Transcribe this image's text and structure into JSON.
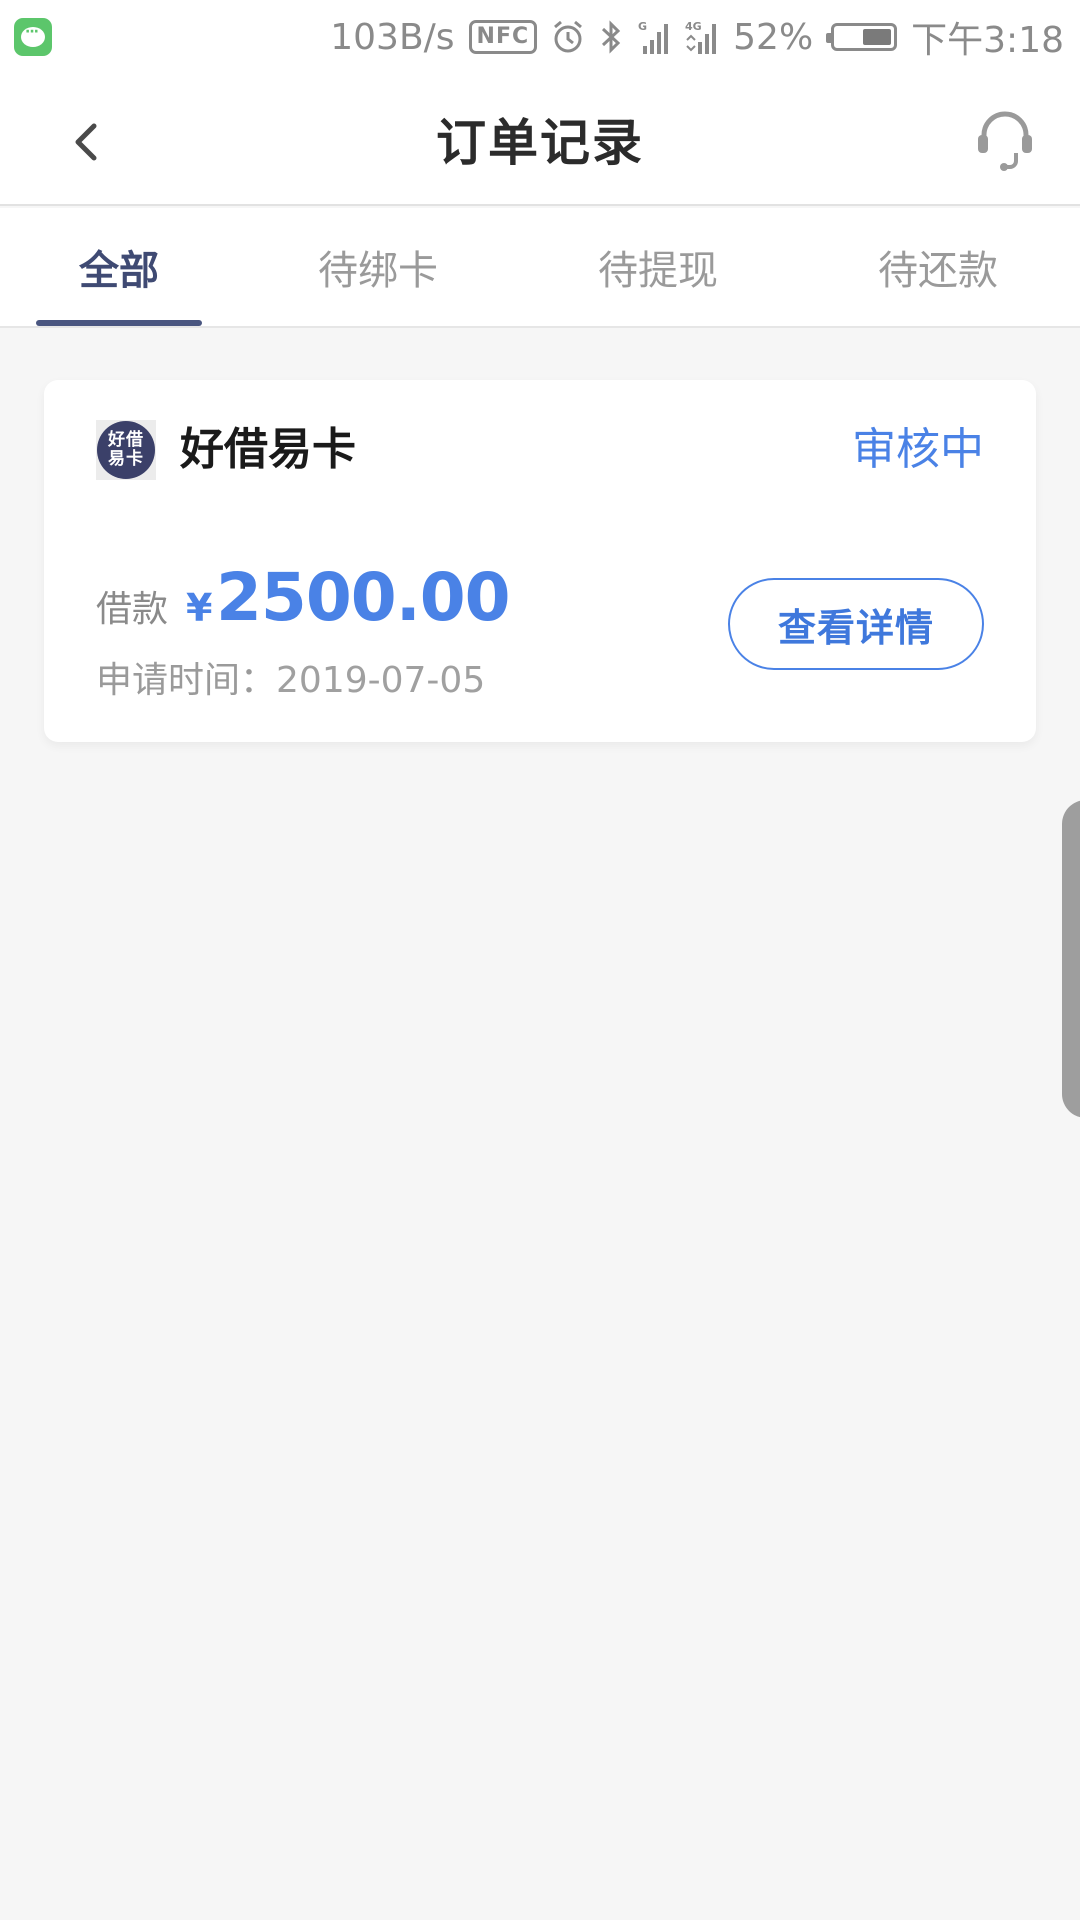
{
  "status_bar": {
    "speed": "103B/s",
    "nfc": "NFC",
    "net_g": "G",
    "net_4g": "4G",
    "battery_percent": "52%",
    "battery_level": 0.52,
    "time": "下午3:18"
  },
  "nav": {
    "title": "订单记录"
  },
  "tabs": [
    {
      "label": "全部",
      "active": true
    },
    {
      "label": "待绑卡",
      "active": false
    },
    {
      "label": "待提现",
      "active": false
    },
    {
      "label": "待还款",
      "active": false
    }
  ],
  "order": {
    "logo_line1": "好借",
    "logo_line2": "易卡",
    "product_name": "好借易卡",
    "status": "审核中",
    "loan_label": "借款",
    "currency": "¥",
    "amount": "2500.00",
    "apply_time_label": "申请时间：",
    "apply_date": "2019-07-05",
    "detail_button": "查看详情"
  },
  "colors": {
    "accent_blue": "#4a82e6",
    "tab_active": "#3f4a73",
    "logo_bg": "#3b4069",
    "wechat_green": "#5cc66b"
  }
}
